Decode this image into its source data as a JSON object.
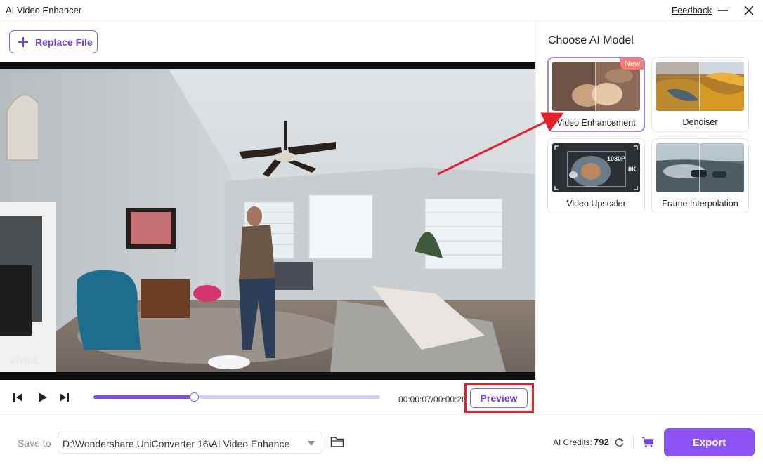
{
  "window": {
    "title": "AI Video Enhancer",
    "feedback_label": "Feedback"
  },
  "toolbar": {
    "replace_file_label": "Replace File"
  },
  "video": {
    "watermark": "vivint."
  },
  "player": {
    "time": "00:00:07/00:00:20",
    "progress": 0.35,
    "preview_label": "Preview"
  },
  "panel": {
    "title": "Choose AI Model",
    "models": [
      {
        "label": "Video Enhancement",
        "badge": "New",
        "selected": true
      },
      {
        "label": "Denoiser",
        "selected": false
      },
      {
        "label": "Video Upscaler",
        "selected": false,
        "thumb_tags": [
          "1080P",
          "8K"
        ]
      },
      {
        "label": "Frame Interpolation",
        "selected": false
      }
    ]
  },
  "footer": {
    "save_label": "Save to",
    "path": "D:\\Wondershare UniConverter 16\\AI Video Enhance",
    "credits_label": "AI Credits:",
    "credits_value": "792",
    "export_label": "Export"
  },
  "colors": {
    "accent": "#8b52f6",
    "accent_text": "#6e3ff0",
    "highlight": "#e4202a",
    "badge": "#ff7a6b"
  },
  "icons": [
    "plus-icon",
    "minimize-icon",
    "close-icon",
    "prev-frame-icon",
    "play-icon",
    "next-frame-icon",
    "folder-icon",
    "refresh-icon",
    "cart-icon",
    "dropdown-caret-icon"
  ]
}
